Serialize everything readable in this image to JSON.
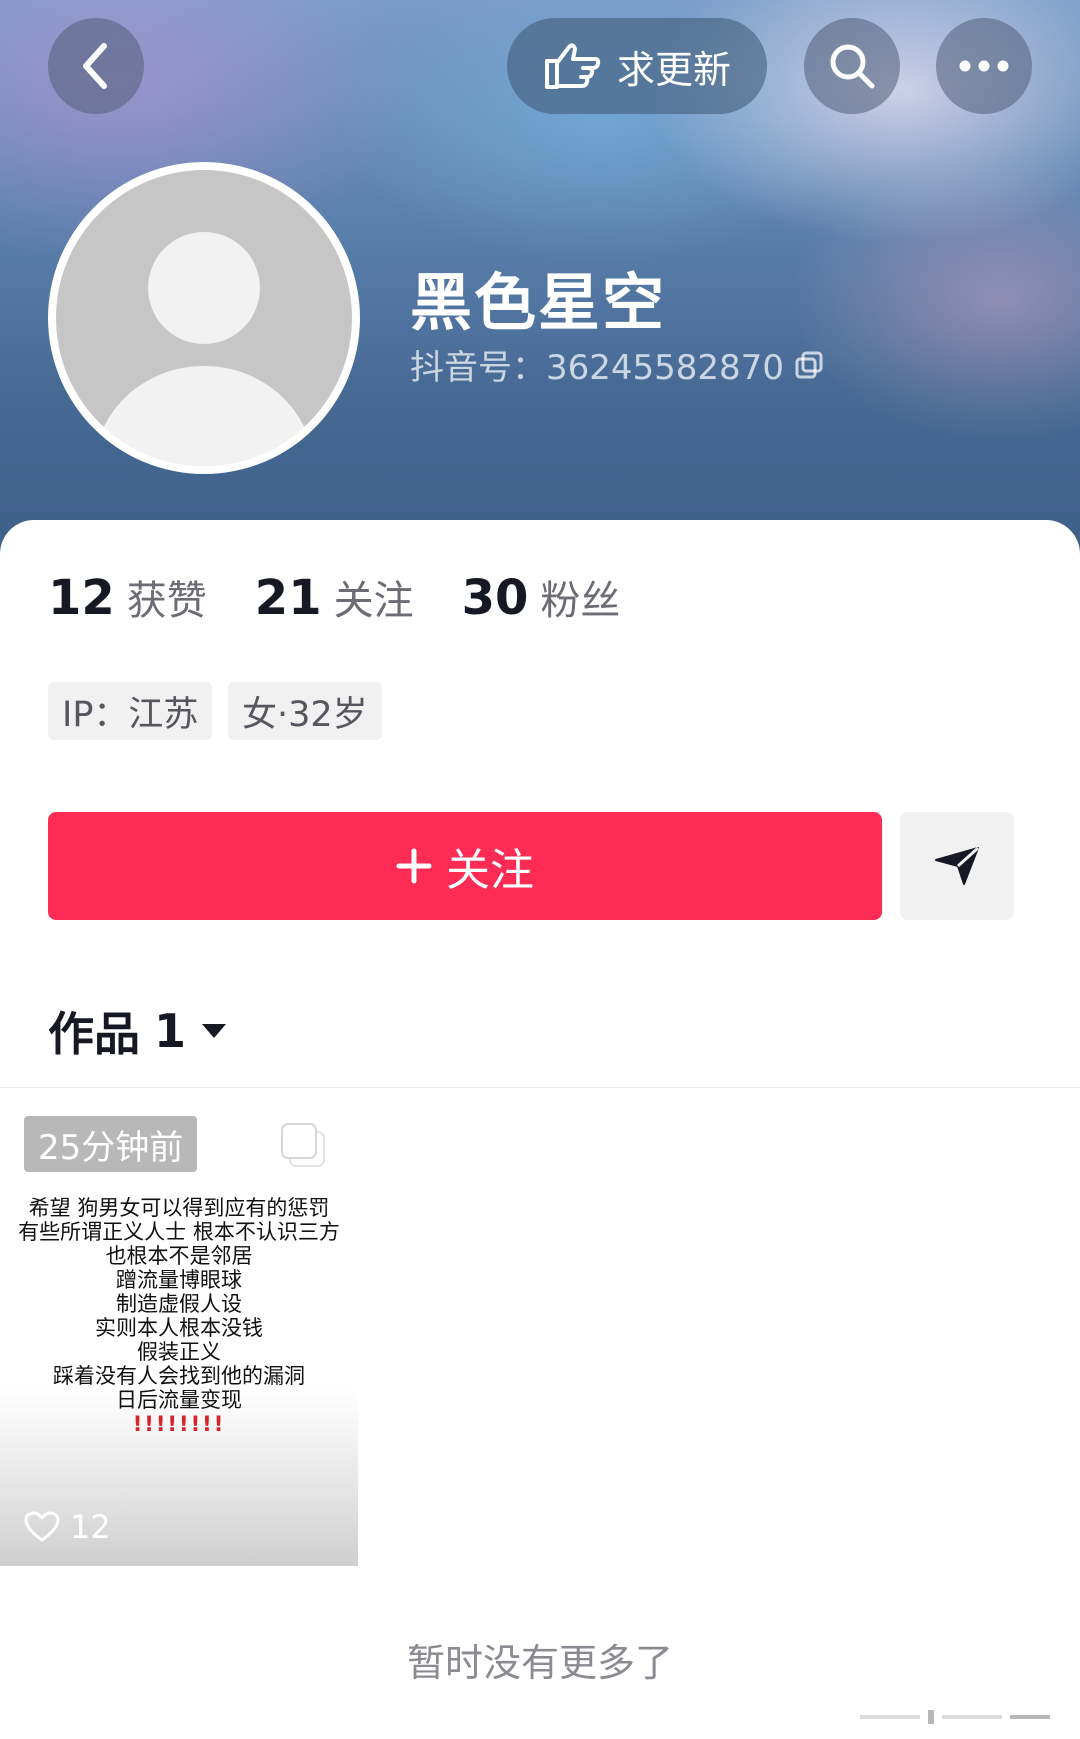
{
  "header": {
    "request_update_label": "求更新",
    "icons": {
      "back": "back-chevron-icon",
      "hand": "pointing-hand-icon",
      "search": "search-icon",
      "more": "more-dots-icon"
    }
  },
  "profile": {
    "nickname": "黑色星空",
    "douyin_id": "抖音号：36245582870",
    "copy_icon": "copy-icon"
  },
  "stats": [
    {
      "value": "12",
      "label": "获赞"
    },
    {
      "value": "21",
      "label": "关注"
    },
    {
      "value": "30",
      "label": "粉丝"
    }
  ],
  "tags": {
    "ip": "IP：江苏",
    "gender_age": "女·32岁"
  },
  "actions": {
    "follow_label": "关注",
    "message_icon": "send-message-icon"
  },
  "works": {
    "label": "作品",
    "count": "1"
  },
  "video": {
    "time_badge": "25分钟前",
    "lines": [
      "希望 狗男女可以得到应有的惩罚",
      "有些所谓正义人士 根本不认识三方",
      "也根本不是邻居",
      "蹭流量博眼球",
      "制造虚假人设",
      "实则本人根本没钱",
      "假装正义",
      "踩着没有人会找到他的漏洞",
      "日后流量变现"
    ],
    "exclamation": "!!!!!!!!",
    "likes": "12"
  },
  "footer": {
    "no_more": "暂时没有更多了"
  },
  "colors": {
    "accent": "#fe2c55",
    "header_blue": "#5f83b0"
  }
}
